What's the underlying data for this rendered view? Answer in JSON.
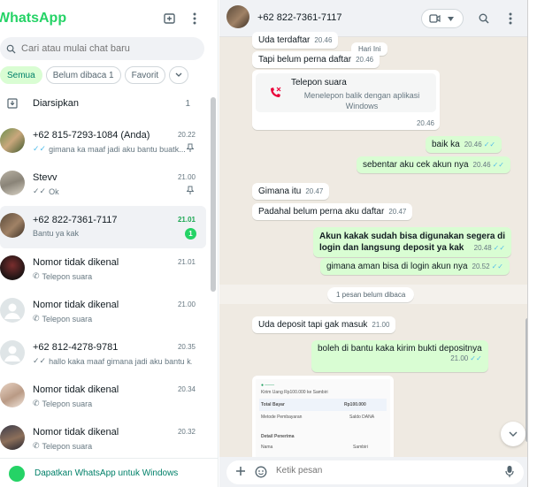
{
  "app": {
    "title": "WhatsApp"
  },
  "left_header": {
    "new_chat_icon": "new-chat-icon",
    "menu_icon": "kebab-menu-icon"
  },
  "search": {
    "placeholder": "Cari atau mulai chat baru"
  },
  "filters": [
    {
      "label": "Semua",
      "active": true
    },
    {
      "label": "Belum dibaca 1",
      "active": false
    },
    {
      "label": "Favorit",
      "active": false
    }
  ],
  "archived": {
    "label": "Diarsipkan",
    "count": "1"
  },
  "chats": [
    {
      "name": "+62 815-7293-1084 (Anda)",
      "time": "20.22",
      "preview": "gimana ka maaf jadi aku bantu buatk...",
      "status": "read",
      "pinned": true
    },
    {
      "name": "Stevv",
      "time": "21.00",
      "preview": "Ok",
      "status": "read",
      "pinned": true
    },
    {
      "name": "+62 822-7361-7117",
      "time": "21.01",
      "preview": "Bantu ya kak",
      "unread": "1",
      "selected": true
    },
    {
      "name": "Nomor tidak dikenal",
      "time": "21.01",
      "preview": "Telepon suara",
      "status": "call"
    },
    {
      "name": "Nomor tidak dikenal",
      "time": "21.00",
      "preview": "Telepon suara",
      "status": "call"
    },
    {
      "name": "+62 812-4278-9781",
      "time": "20.35",
      "preview": "hallo kaka maaf gimana jadi aku bantu k...",
      "status": "read"
    },
    {
      "name": "Nomor tidak dikenal",
      "time": "20.34",
      "preview": "Telepon suara",
      "status": "call"
    },
    {
      "name": "Nomor tidak dikenal",
      "time": "20.32",
      "preview": "Telepon suara",
      "status": "call"
    }
  ],
  "promo": {
    "label": "Dapatkan WhatsApp untuk Windows"
  },
  "conversation": {
    "contact": "+62 822-7361-7117",
    "day_chip": "Hari Ini",
    "unread_chip": "1 pesan belum dibaca",
    "messages": [
      {
        "dir": "in",
        "text": "Uda terdaftar",
        "time": "20.46"
      },
      {
        "dir": "in",
        "text": "Tapi belum perna daftar",
        "time": "20.46"
      },
      {
        "dir": "in",
        "type": "call",
        "title": "Telepon suara",
        "subtitle": "Menelepon balik dengan aplikasi Windows",
        "time": "20.46"
      },
      {
        "dir": "out",
        "text": "baik ka",
        "time": "20.46"
      },
      {
        "dir": "out",
        "text": "sebentar aku cek akun nya",
        "time": "20.46"
      },
      {
        "dir": "in",
        "text": "Gimana itu",
        "time": "20.47"
      },
      {
        "dir": "in",
        "text": "Padahal belum perna aku daftar",
        "time": "20.47"
      },
      {
        "dir": "out",
        "text_line1": "Akun kakak sudah bisa digunakan segera di",
        "text_line2": "login dan langsung deposit ya kak",
        "time": "20.48"
      },
      {
        "dir": "out",
        "text": "gimana aman bisa di login akun nya",
        "time": "20.52"
      },
      {
        "dir": "in",
        "text": "Uda deposit tapi gak masuk",
        "time": "21.00"
      },
      {
        "dir": "out",
        "text": "boleh di bantu kaka kirim bukti depositnya",
        "time": "21.00"
      }
    ],
    "receipt": {
      "header": "Kirim Uang Rp100.000 ke Sambiri",
      "total_label": "Total Bayar",
      "total_value": "Rp100.000",
      "method_label": "Metode Pembayaran",
      "method_value": "Saldo DANA",
      "section": "Detail Penerima",
      "recipient_label": "Nama",
      "recipient_value": "Sambiri"
    },
    "composer_placeholder": "Ketik pesan"
  },
  "colors": {
    "brand": "#25d366",
    "outgoing_bubble": "#d9fdd3",
    "chat_bg": "#efeae2",
    "tick_blue": "#53bdeb"
  }
}
